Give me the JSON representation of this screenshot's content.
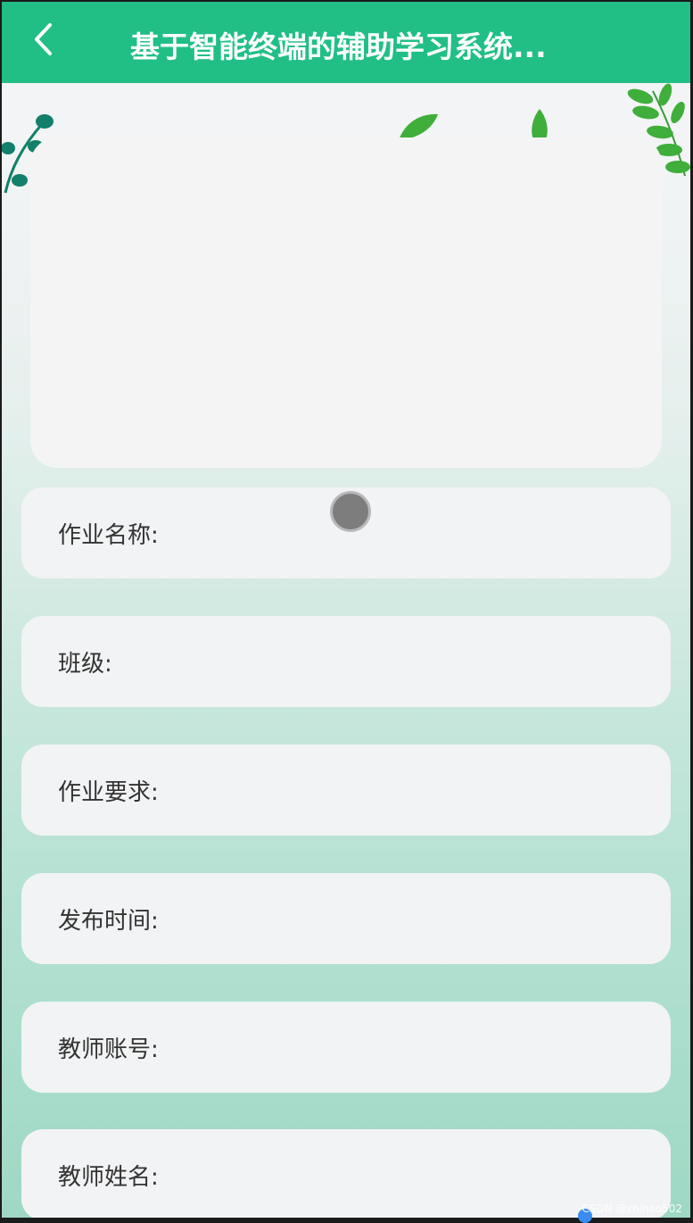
{
  "header": {
    "title": "基于智能终端的辅助学习系统...",
    "back_icon": "chevron-left-icon",
    "background_color": "#21bf86"
  },
  "fields": [
    {
      "label": "作业名称:"
    },
    {
      "label": "班级:"
    },
    {
      "label": "作业要求:"
    },
    {
      "label": "发布时间:"
    },
    {
      "label": "教师账号:"
    },
    {
      "label": "教师姓名:"
    }
  ],
  "watermark": "CSDN @zhihao502",
  "colors": {
    "accent": "#21bf86",
    "leaf_dark": "#12806a",
    "leaf_green": "#3fae3a"
  }
}
